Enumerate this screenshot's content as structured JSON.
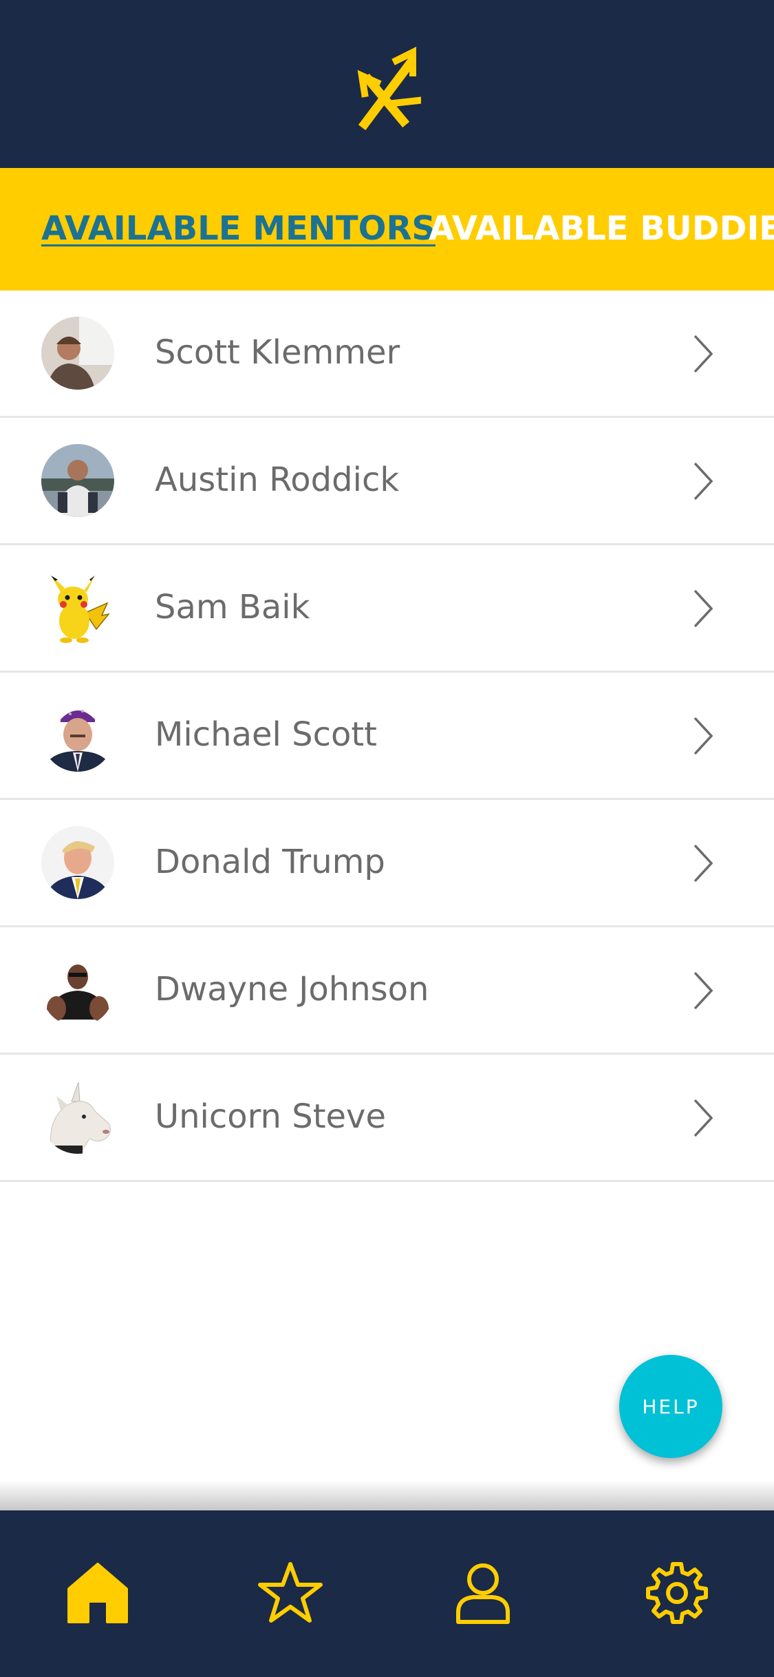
{
  "header": {
    "logo": "trident-logo-icon"
  },
  "tabs": [
    {
      "label": "AVAILABLE MENTORS",
      "active": true
    },
    {
      "label": "AVAILABLE BUDDIES",
      "active": false
    }
  ],
  "mentors": [
    {
      "name": "Scott Klemmer",
      "avatar": "photo-avatar"
    },
    {
      "name": "Austin Roddick",
      "avatar": "photo-avatar"
    },
    {
      "name": "Sam Baik",
      "avatar": "pikachu-avatar"
    },
    {
      "name": "Michael Scott",
      "avatar": "photo-avatar"
    },
    {
      "name": "Donald Trump",
      "avatar": "photo-avatar"
    },
    {
      "name": "Dwayne Johnson",
      "avatar": "photo-avatar"
    },
    {
      "name": "Unicorn Steve",
      "avatar": "unicorn-avatar"
    }
  ],
  "help_button": {
    "label": "HELP"
  },
  "bottom_nav": [
    {
      "icon": "home-icon",
      "active": true
    },
    {
      "icon": "star-icon",
      "active": false
    },
    {
      "icon": "user-icon",
      "active": false
    },
    {
      "icon": "gear-icon",
      "active": false
    }
  ],
  "colors": {
    "navy": "#1a2a47",
    "yellow": "#ffcd00",
    "active_tab": "#1c7292",
    "help": "#00c1d5"
  }
}
